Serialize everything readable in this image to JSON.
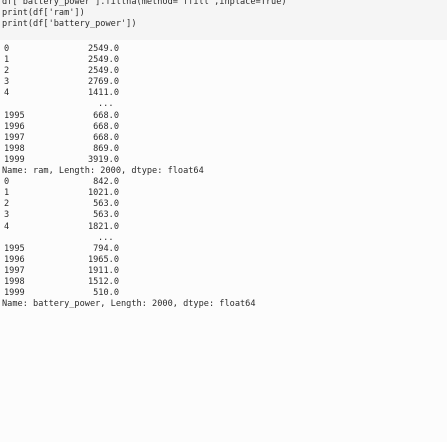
{
  "code": {
    "line0": "df[ battery_power ].fillna(method= ffill ,inplace=True)",
    "line1": "print(df['ram'])",
    "line2": "print(df['battery_power'])"
  },
  "output": {
    "ram": {
      "head": [
        {
          "index": "0",
          "value": "2549.0"
        },
        {
          "index": "1",
          "value": "2549.0"
        },
        {
          "index": "2",
          "value": "2549.0"
        },
        {
          "index": "3",
          "value": "2769.0"
        },
        {
          "index": "4",
          "value": "1411.0"
        }
      ],
      "ellipsis": "...",
      "tail": [
        {
          "index": "1995",
          "value": "668.0"
        },
        {
          "index": "1996",
          "value": "668.0"
        },
        {
          "index": "1997",
          "value": "668.0"
        },
        {
          "index": "1998",
          "value": "869.0"
        },
        {
          "index": "1999",
          "value": "3919.0"
        }
      ],
      "footer": "Name: ram, Length: 2000, dtype: float64"
    },
    "battery_power": {
      "head": [
        {
          "index": "0",
          "value": "842.0"
        },
        {
          "index": "1",
          "value": "1021.0"
        },
        {
          "index": "2",
          "value": "563.0"
        },
        {
          "index": "3",
          "value": "563.0"
        },
        {
          "index": "4",
          "value": "1821.0"
        }
      ],
      "ellipsis": "...",
      "tail": [
        {
          "index": "1995",
          "value": "794.0"
        },
        {
          "index": "1996",
          "value": "1965.0"
        },
        {
          "index": "1997",
          "value": "1911.0"
        },
        {
          "index": "1998",
          "value": "1512.0"
        },
        {
          "index": "1999",
          "value": "510.0"
        }
      ],
      "footer": "Name: battery_power, Length: 2000, dtype: float64"
    }
  }
}
